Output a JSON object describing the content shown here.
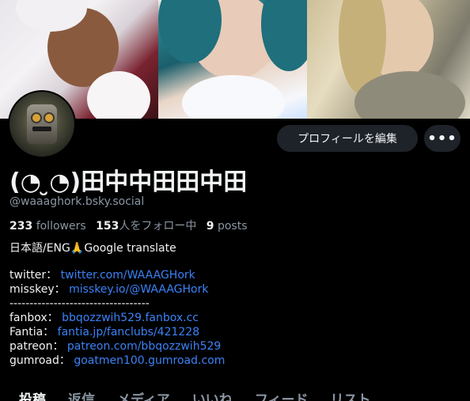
{
  "profile": {
    "display_name": "(◔ ̮◔)田中中田田中田",
    "handle": "@waaaghork.bsky.social",
    "edit_button": "プロフィールを編集",
    "more_button": "•••",
    "stats": {
      "followers_count": "233",
      "followers_label": "followers",
      "following_count": "153",
      "following_label": "人をフォロー中",
      "posts_count": "9",
      "posts_label": "posts"
    }
  },
  "bio": {
    "line1": "日本語/ENG🙏Google translate",
    "twitter_label": "twitter： ",
    "twitter_link": "twitter.com/WAAAGHork",
    "misskey_label": "misskey： ",
    "misskey_link": "misskey.io/@WAAAGHork",
    "divider": "-----------------------------------",
    "fanbox_label": "fanbox： ",
    "fanbox_link": "bbqozzwih529.fanbox.cc",
    "fantia_label": "Fantia： ",
    "fantia_link": "fantia.jp/fanclubs/421228",
    "patreon_label": "patreon： ",
    "patreon_link": "patreon.com/bbqozzwih529",
    "gumroad_label": "gumroad： ",
    "gumroad_link": "goatmen100.gumroad.com"
  },
  "tabs": [
    {
      "label": "投稿"
    },
    {
      "label": "返信"
    },
    {
      "label": "メディア"
    },
    {
      "label": "いいね"
    },
    {
      "label": "フィード"
    },
    {
      "label": "リスト"
    }
  ],
  "colors": {
    "background": "#000000",
    "link": "#3b82f6",
    "muted": "#8a96a3",
    "button_bg": "#1e2329"
  }
}
